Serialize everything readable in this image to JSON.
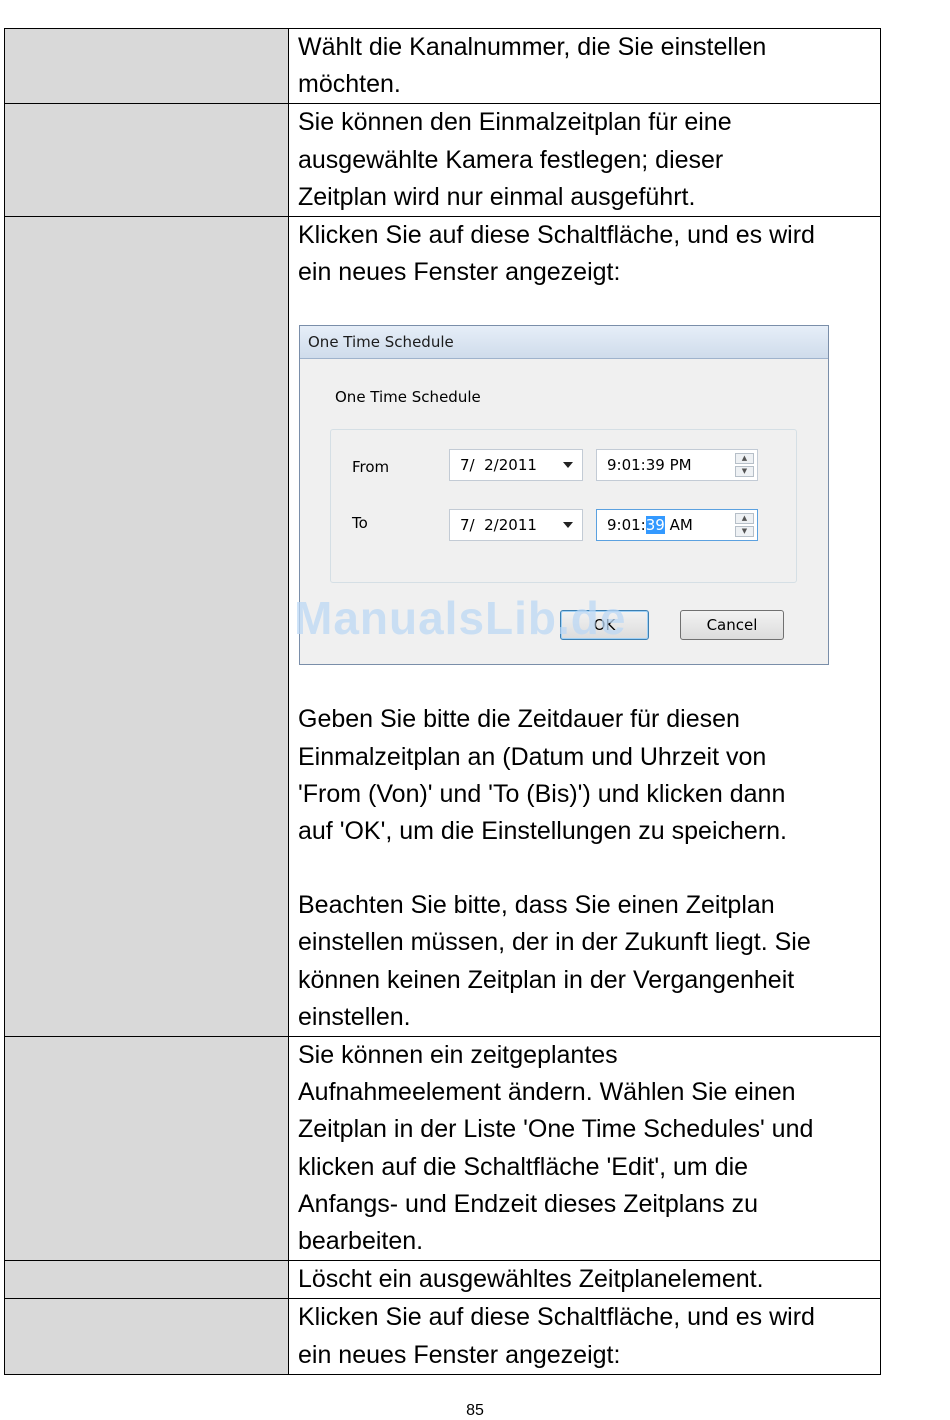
{
  "rows": [
    {
      "lines": [
        "Wählt die Kanalnummer, die Sie einstellen",
        "möchten."
      ]
    },
    {
      "lines": [
        "Sie können den Einmalzeitplan für eine",
        "ausgewählte Kamera festlegen; dieser",
        "Zeitplan wird nur einmal ausgeführt."
      ]
    },
    {
      "intro": [
        "Klicken Sie auf diese Schaltfläche, und es wird",
        "ein neues Fenster angezeigt:"
      ],
      "para1": [
        "Geben Sie bitte die Zeitdauer für diesen",
        "Einmalzeitplan an (Datum und Uhrzeit von",
        "'From (Von)' und 'To (Bis)') und klicken dann",
        "auf 'OK', um die Einstellungen zu speichern."
      ],
      "para2": [
        "Beachten Sie bitte, dass Sie einen Zeitplan",
        "einstellen müssen, der in der Zukunft liegt. Sie",
        "können keinen Zeitplan in der Vergangenheit",
        "einstellen."
      ]
    },
    {
      "lines": [
        "Sie können ein zeitgeplantes",
        "Aufnahmeelement ändern. Wählen Sie einen",
        "Zeitplan in der Liste 'One Time Schedules' und",
        "klicken auf die Schaltfläche 'Edit', um die",
        "Anfangs- und Endzeit dieses Zeitplans zu",
        "bearbeiten."
      ]
    },
    {
      "lines": [
        "Löscht ein ausgewähltes Zeitplanelement."
      ]
    },
    {
      "lines": [
        "Klicken Sie auf diese Schaltfläche, und es wird",
        "ein neues Fenster angezeigt:"
      ]
    }
  ],
  "dialog": {
    "title": "One Time Schedule",
    "heading": "One Time Schedule",
    "from_label": "From",
    "from_date": "7/  2/2011",
    "from_time": "9:01:39 PM",
    "to_label": "To",
    "to_date": "7/  2/2011",
    "to_time_prefix": "9:01:",
    "to_time_selected": "39",
    "to_time_suffix": " AM",
    "ok_label": "OK",
    "cancel_label": "Cancel"
  },
  "watermark": "ManualsLib.de",
  "page_number": "85"
}
